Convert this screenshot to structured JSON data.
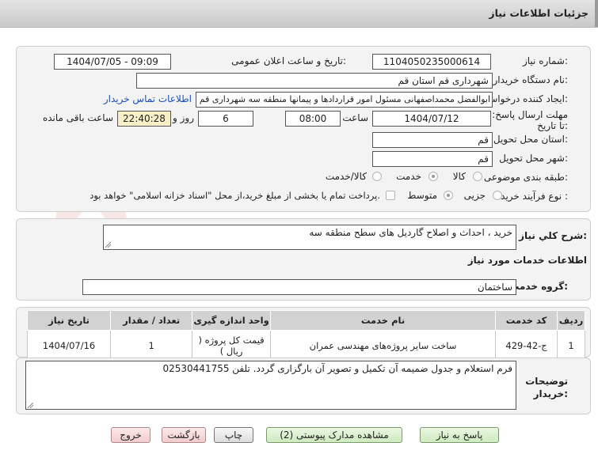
{
  "header": {
    "title": "جزئیات اطلاعات نیاز"
  },
  "form": {
    "need_number_label": "شماره نیاز:",
    "need_number": "1104050235000614",
    "announce_label": "تاریخ و ساعت اعلان عمومی:",
    "announce_value": "1404/07/05 - 09:09",
    "buyer_org_label": "نام دستگاه خریدار:",
    "buyer_org": "شهرداری قم استان قم",
    "creator_label": "ایجاد کننده درخواست:",
    "creator": "ابوالفضل محمداصفهانی مسئول امور قراردادها و پیمانها منطقه سه شهرداری قم",
    "contact_link": "اطلاعات تماس خریدار",
    "deadline_label": "مهلت ارسال پاسخ: تا تاریخ:",
    "deadline_date": "1404/07/12",
    "time_label": "ساعت",
    "deadline_time": "08:00",
    "days": "6",
    "days_label": "روز و",
    "remaining_time": "22:40:28",
    "remaining_label": "ساعت باقی مانده",
    "province_label": "استان محل تحویل:",
    "province": "قم",
    "city_label": "شهر محل تحویل:",
    "city": "قم",
    "category_label": "طبقه بندی موضوعی:",
    "category_options": {
      "goods": "کالا",
      "service": "خدمت",
      "goods_service": "کالا/خدمت"
    },
    "category_selected": "service",
    "process_label": "نوع فرآیند خرید :",
    "process_options": {
      "minor": "جزیی",
      "medium": "متوسط"
    },
    "process_selected": "medium",
    "payment_note": "پرداخت تمام یا بخشی از مبلغ خرید،از محل \"اسناد خزانه اسلامی\" خواهد بود."
  },
  "need": {
    "summary_label": "شرح کلي نياز:",
    "summary": "خرید ، احداث و اصلاح گاردیل های سطح منطقه سه",
    "services_heading": "اطلاعات خدمات مورد نياز",
    "group_label": "گروه خدمت:",
    "group": "ساختمان"
  },
  "table": {
    "headers": {
      "row": "ردیف",
      "code": "کد خدمت",
      "name": "نام خدمت",
      "unit": "واحد اندازه گیری",
      "qty": "تعداد / مقدار",
      "date": "تاریخ نیاز"
    },
    "rows": [
      {
        "row": "1",
        "code": "ج-42-429",
        "name": "ساخت سایر پروژه‌های مهندسی عمران",
        "unit": "قیمت کل پروژه ( ریال )",
        "qty": "1",
        "date": "1404/07/16"
      }
    ]
  },
  "notes": {
    "label": "توضیحات خریدار:",
    "text": "فرم استعلام و جدول ضمیمه آن تکمیل و تصویر آن بارگزاری گردد. تلفن 02530441755"
  },
  "buttons": {
    "reply": "پاسخ به نیاز",
    "attachments": "مشاهده مدارک پیوستی (2)",
    "print": "چاپ",
    "back": "بازگشت",
    "exit": "خروج"
  },
  "watermark": {
    "text": "AriaTender.net"
  }
}
